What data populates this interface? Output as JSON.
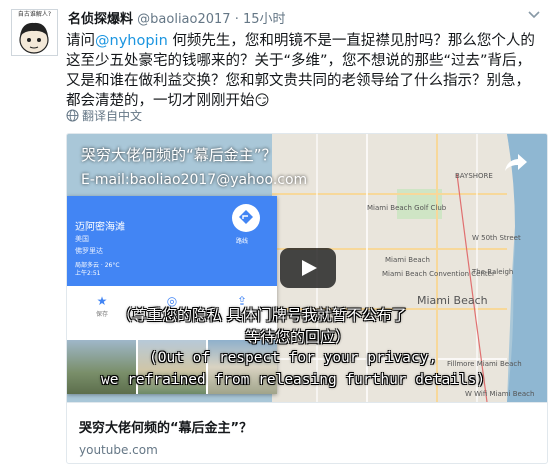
{
  "tweet": {
    "avatar_text": "自古谁解人?",
    "display_name": "名侦探爆料",
    "handle": "@baoliao2017",
    "dot": "·",
    "time": "15小时",
    "text_prefix": "请问",
    "mention": "@nyhopin",
    "text_rest": " 何频先生，您和明镜不是一直捉襟见肘吗？那么您个人的这至少五处豪宅的钱哪来的？关于“多维”，您不想说的那些“过去”背后，又是和谁在做利益交换？您和郭文贵共同的老领导给了什么指示？别急，都会清楚的，一切才刚刚开始😏",
    "translate_label": "翻译自中文"
  },
  "card": {
    "video_title": "哭穷大佬何频的“幕后金主”？",
    "video_email": "E-mail:baoliao2017@yahoo.com",
    "subtitle_zh_1": "（尊重您的隐私 具体门牌号我就暂不公布了",
    "subtitle_zh_2": "等待您的回应）",
    "subtitle_en_1": "(Out of respect for your privacy,",
    "subtitle_en_2": "we refrained from releasing furthur details)",
    "gmaps": {
      "place_name": "迈阿密海滩",
      "line1": "美国",
      "line2": "佛罗里达",
      "weather1": "局部多云 · 26°C",
      "weather2": "上午2:51",
      "route_label": "路线",
      "actions": [
        {
          "icon": "★",
          "label": "保存"
        },
        {
          "icon": "◎",
          "label": "附近"
        },
        {
          "icon": "⇪",
          "label": "分享"
        }
      ]
    },
    "map_labels": [
      "Miami Beach Golf Club",
      "BAYSHORE",
      "W 50th Street",
      "Miami Beach",
      "Miami Beach Convention Center",
      "The Raleigh",
      "Miami Beach",
      "Fillmore Miami Beach",
      "W Wifi Miami Beach"
    ],
    "title": "哭穷大佬何频的“幕后金主”？",
    "domain": "youtube.com"
  },
  "colors": {
    "link": "#1b95e0",
    "meta": "#657786",
    "gmaps_blue": "#4285f4",
    "play": "#1e1e1e"
  },
  "icons": {
    "caret": "chevron-down-icon",
    "translate": "globe-icon",
    "share": "share-arrow-icon",
    "play": "play-icon",
    "nav": "navigation-icon"
  }
}
